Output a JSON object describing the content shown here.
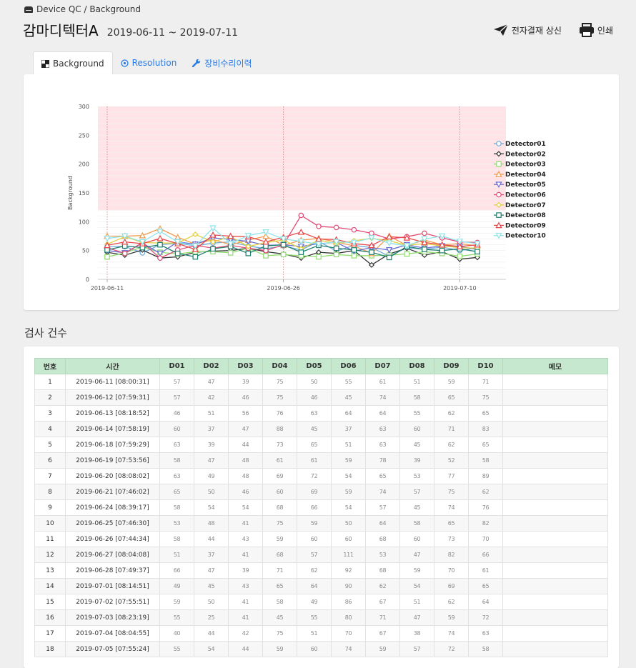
{
  "breadcrumb": {
    "text": "Device QC / Background"
  },
  "header": {
    "title": "감마디텍터A",
    "date_range": "2019-06-11 ~ 2019-07-11"
  },
  "actions": {
    "submit_label": "전자결재 상신",
    "print_label": "인쇄"
  },
  "tabs": [
    {
      "label": "Background",
      "icon": "background-icon",
      "active": true
    },
    {
      "label": "Resolution",
      "icon": "target-icon",
      "active": false
    },
    {
      "label": "장비수리이력",
      "icon": "wrench-icon",
      "active": false
    }
  ],
  "section": {
    "title": "검사 건수"
  },
  "colors": {
    "accent": "#2a7ae2",
    "table_header": "#c6e8cf",
    "alarm_band": "#ffe3e6"
  },
  "table": {
    "headers": [
      "번호",
      "시간",
      "D01",
      "D02",
      "D03",
      "D04",
      "D05",
      "D06",
      "D07",
      "D08",
      "D09",
      "D10",
      "메모"
    ],
    "rows": [
      [
        "1",
        "2019-06-11 [08:00:31]",
        "57",
        "47",
        "39",
        "75",
        "50",
        "55",
        "61",
        "51",
        "59",
        "71",
        ""
      ],
      [
        "2",
        "2019-06-12 [07:59:31]",
        "57",
        "42",
        "46",
        "75",
        "46",
        "45",
        "74",
        "58",
        "65",
        "75",
        ""
      ],
      [
        "3",
        "2019-06-13 [08:18:52]",
        "46",
        "51",
        "56",
        "76",
        "63",
        "64",
        "64",
        "55",
        "62",
        "65",
        ""
      ],
      [
        "4",
        "2019-06-14 [07:58:19]",
        "60",
        "37",
        "47",
        "88",
        "45",
        "37",
        "63",
        "60",
        "71",
        "83",
        ""
      ],
      [
        "5",
        "2019-06-18 [07:59:29]",
        "63",
        "39",
        "44",
        "73",
        "65",
        "51",
        "63",
        "45",
        "62",
        "65",
        ""
      ],
      [
        "6",
        "2019-06-19 [07:53:56]",
        "58",
        "47",
        "48",
        "61",
        "61",
        "59",
        "78",
        "39",
        "52",
        "58",
        ""
      ],
      [
        "7",
        "2019-06-20 [08:08:02]",
        "63",
        "49",
        "48",
        "69",
        "72",
        "54",
        "65",
        "53",
        "77",
        "89",
        ""
      ],
      [
        "8",
        "2019-06-21 [07:46:02]",
        "65",
        "50",
        "46",
        "60",
        "69",
        "59",
        "74",
        "57",
        "75",
        "62",
        ""
      ],
      [
        "9",
        "2019-06-24 [08:39:17]",
        "58",
        "54",
        "54",
        "68",
        "66",
        "54",
        "57",
        "45",
        "74",
        "76",
        ""
      ],
      [
        "10",
        "2019-06-25 [07:46:30]",
        "53",
        "48",
        "41",
        "75",
        "59",
        "50",
        "64",
        "58",
        "65",
        "82",
        ""
      ],
      [
        "11",
        "2019-06-26 [07:44:34]",
        "58",
        "44",
        "43",
        "59",
        "60",
        "60",
        "68",
        "60",
        "73",
        "70",
        ""
      ],
      [
        "12",
        "2019-06-27 [08:04:08]",
        "51",
        "37",
        "41",
        "68",
        "57",
        "111",
        "53",
        "47",
        "82",
        "66",
        ""
      ],
      [
        "13",
        "2019-06-28 [07:49:37]",
        "66",
        "47",
        "39",
        "71",
        "62",
        "92",
        "68",
        "59",
        "70",
        "61",
        ""
      ],
      [
        "14",
        "2019-07-01 [08:14:51]",
        "49",
        "45",
        "43",
        "65",
        "64",
        "90",
        "62",
        "54",
        "69",
        "65",
        ""
      ],
      [
        "15",
        "2019-07-02 [07:55:51]",
        "59",
        "50",
        "41",
        "58",
        "49",
        "86",
        "67",
        "51",
        "62",
        "64",
        ""
      ],
      [
        "16",
        "2019-07-03 [08:23:19]",
        "55",
        "25",
        "41",
        "45",
        "55",
        "80",
        "71",
        "47",
        "59",
        "72",
        ""
      ],
      [
        "17",
        "2019-07-04 [08:04:55]",
        "40",
        "44",
        "42",
        "75",
        "51",
        "70",
        "67",
        "38",
        "74",
        "63",
        ""
      ],
      [
        "18",
        "2019-07-05 [07:55:24]",
        "55",
        "54",
        "44",
        "59",
        "60",
        "74",
        "59",
        "57",
        "72",
        "58",
        ""
      ]
    ]
  },
  "chart_data": {
    "type": "line",
    "ylabel": "Background",
    "ylim": [
      0,
      300
    ],
    "yticks": [
      0,
      50,
      100,
      150,
      200,
      250,
      300
    ],
    "x": [
      "2019-06-11",
      "2019-06-12",
      "2019-06-13",
      "2019-06-14",
      "2019-06-18",
      "2019-06-19",
      "2019-06-20",
      "2019-06-21",
      "2019-06-24",
      "2019-06-25",
      "2019-06-26",
      "2019-06-27",
      "2019-06-28",
      "2019-07-01",
      "2019-07-02",
      "2019-07-03",
      "2019-07-04",
      "2019-07-05",
      "2019-07-08",
      "2019-07-09",
      "2019-07-10",
      "2019-07-11"
    ],
    "xtick_labels": [
      "2019-06-11",
      "2019-06-26",
      "2019-07-10"
    ],
    "xtick_dates": [
      "2019-06-11",
      "2019-06-26",
      "2019-07-10"
    ],
    "alarm_range": [
      120,
      300
    ],
    "legend_position": "right",
    "series": [
      {
        "name": "Detector01",
        "color": "#6fa9d6",
        "marker": "circle",
        "values": [
          57,
          57,
          46,
          60,
          63,
          58,
          63,
          65,
          58,
          53,
          58,
          51,
          66,
          49,
          59,
          55,
          40,
          55,
          52,
          56,
          50,
          55
        ]
      },
      {
        "name": "Detector02",
        "color": "#333333",
        "marker": "diamond",
        "values": [
          47,
          42,
          51,
          37,
          39,
          47,
          49,
          50,
          54,
          48,
          44,
          37,
          47,
          45,
          50,
          25,
          44,
          54,
          42,
          48,
          35,
          38
        ]
      },
      {
        "name": "Detector03",
        "color": "#8fdb6f",
        "marker": "square",
        "values": [
          39,
          46,
          56,
          47,
          44,
          48,
          48,
          46,
          54,
          41,
          43,
          41,
          39,
          43,
          41,
          41,
          42,
          44,
          48,
          45,
          40,
          44
        ]
      },
      {
        "name": "Detector04",
        "color": "#ef9b50",
        "marker": "triangle",
        "values": [
          75,
          75,
          76,
          88,
          73,
          61,
          69,
          60,
          68,
          75,
          59,
          68,
          71,
          65,
          58,
          45,
          75,
          59,
          68,
          60,
          62,
          58
        ]
      },
      {
        "name": "Detector05",
        "color": "#6a6fd2",
        "marker": "triangle-down",
        "values": [
          50,
          46,
          63,
          45,
          65,
          61,
          72,
          69,
          66,
          59,
          60,
          57,
          62,
          64,
          49,
          55,
          51,
          60,
          54,
          58,
          57,
          52
        ]
      },
      {
        "name": "Detector06",
        "color": "#e04a73",
        "marker": "circle",
        "values": [
          55,
          45,
          64,
          37,
          51,
          59,
          54,
          59,
          54,
          50,
          60,
          111,
          92,
          90,
          86,
          80,
          70,
          74,
          80,
          72,
          65,
          64
        ]
      },
      {
        "name": "Detector07",
        "color": "#e1d03f",
        "marker": "diamond",
        "values": [
          61,
          74,
          64,
          63,
          63,
          78,
          65,
          74,
          57,
          64,
          68,
          53,
          68,
          62,
          67,
          71,
          67,
          59,
          62,
          58,
          55,
          54
        ]
      },
      {
        "name": "Detector08",
        "color": "#1f7e6e",
        "marker": "square",
        "values": [
          51,
          58,
          55,
          60,
          45,
          39,
          53,
          57,
          45,
          58,
          60,
          47,
          59,
          54,
          51,
          47,
          38,
          57,
          52,
          50,
          53,
          48
        ]
      },
      {
        "name": "Detector09",
        "color": "#e8474a",
        "marker": "triangle",
        "values": [
          59,
          65,
          62,
          71,
          62,
          52,
          77,
          75,
          74,
          65,
          73,
          82,
          70,
          69,
          62,
          59,
          74,
          72,
          64,
          60,
          57,
          60
        ]
      },
      {
        "name": "Detector10",
        "color": "#8fe4ea",
        "marker": "triangle-down",
        "values": [
          71,
          75,
          65,
          83,
          65,
          58,
          89,
          62,
          76,
          82,
          70,
          66,
          61,
          65,
          64,
          72,
          63,
          58,
          70,
          75,
          66,
          62
        ]
      }
    ]
  }
}
